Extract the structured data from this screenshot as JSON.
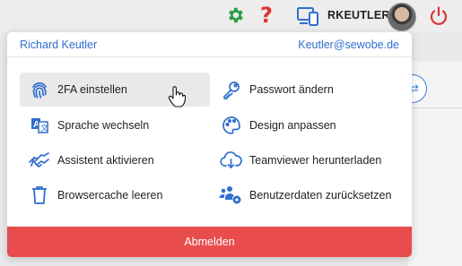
{
  "topbar": {
    "username": "RKEUTLER",
    "help_glyph": "?",
    "icons": [
      "gear-icon",
      "help-icon",
      "device-icon",
      "avatar",
      "power-icon"
    ],
    "colors": {
      "gear": "#2e9e4a",
      "help": "#e03434",
      "device": "#2f6fce",
      "power": "#e03434"
    }
  },
  "bg": {
    "button_glyph": "⇄"
  },
  "menu": {
    "name": "Richard Keutler",
    "email": "Keutler@sewobe.de",
    "items": [
      {
        "label": "2FA einstellen",
        "icon": "fingerprint-icon"
      },
      {
        "label": "Passwort ändern",
        "icon": "key-icon"
      },
      {
        "label": "Sprache wechseln",
        "icon": "translate-icon"
      },
      {
        "label": "Design anpassen",
        "icon": "palette-icon"
      },
      {
        "label": "Assistent aktivieren",
        "icon": "handshake-icon"
      },
      {
        "label": "Teamviewer herunterladen",
        "icon": "cloud-download-icon"
      },
      {
        "label": "Browsercache leeren",
        "icon": "trash-icon"
      },
      {
        "label": "Benutzerdaten zurücksetzen",
        "icon": "users-settings-icon"
      }
    ],
    "logout_label": "Abmelden",
    "colors": {
      "accent": "#2f6fce",
      "logout": "#e84c4c",
      "hover": "#e9e9e9"
    }
  }
}
